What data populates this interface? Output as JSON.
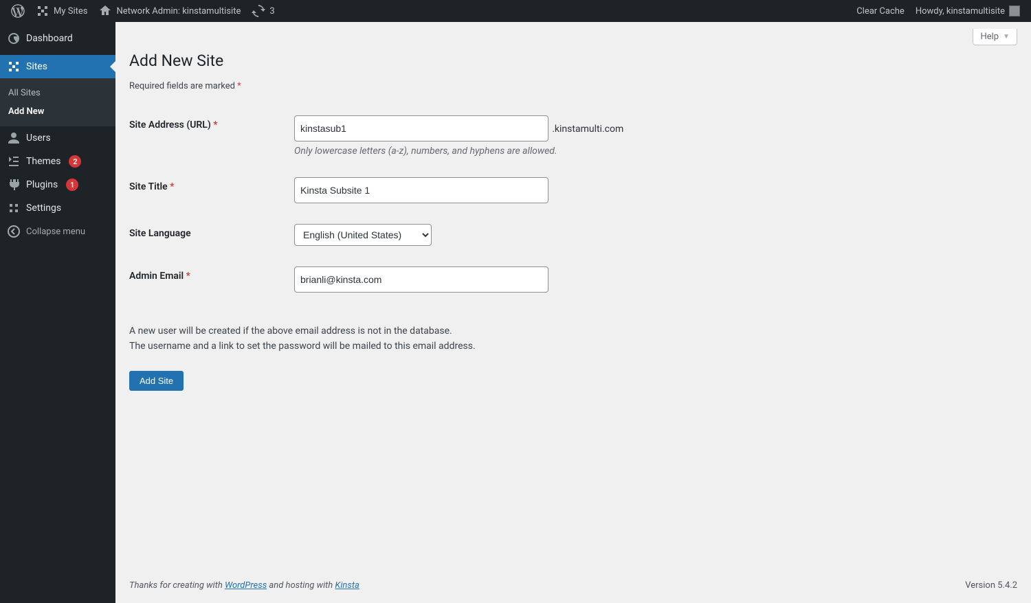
{
  "adminbar": {
    "my_sites": "My Sites",
    "network_admin": "Network Admin: kinstamultisite",
    "comments_count": "3",
    "clear_cache": "Clear Cache",
    "howdy": "Howdy, kinstamultisite"
  },
  "sidebar": {
    "dashboard": "Dashboard",
    "sites": "Sites",
    "sites_sub": {
      "all": "All Sites",
      "add_new": "Add New"
    },
    "users": "Users",
    "themes": "Themes",
    "themes_count": "2",
    "plugins": "Plugins",
    "plugins_count": "1",
    "settings": "Settings",
    "collapse": "Collapse menu"
  },
  "page": {
    "help": "Help",
    "title": "Add New Site",
    "required_legend": "Required fields are marked ",
    "required_mark": "*"
  },
  "form": {
    "site_address": {
      "label": "Site Address (URL) ",
      "req": "*",
      "value": "kinstasub1",
      "suffix": ".kinstamulti.com",
      "hint": "Only lowercase letters (a-z), numbers, and hyphens are allowed."
    },
    "site_title": {
      "label": "Site Title ",
      "req": "*",
      "value": "Kinsta Subsite 1"
    },
    "site_language": {
      "label": "Site Language",
      "value": "English (United States)"
    },
    "admin_email": {
      "label": "Admin Email ",
      "req": "*",
      "value": "brianli@kinsta.com"
    },
    "info_line1": "A new user will be created if the above email address is not in the database.",
    "info_line2": "The username and a link to set the password will be mailed to this email address.",
    "submit": "Add Site"
  },
  "footer": {
    "thanks_prefix": "Thanks for creating with ",
    "wp_link": "WordPress",
    "thanks_mid": " and hosting with ",
    "kinsta_link": "Kinsta",
    "version": "Version 5.4.2"
  }
}
